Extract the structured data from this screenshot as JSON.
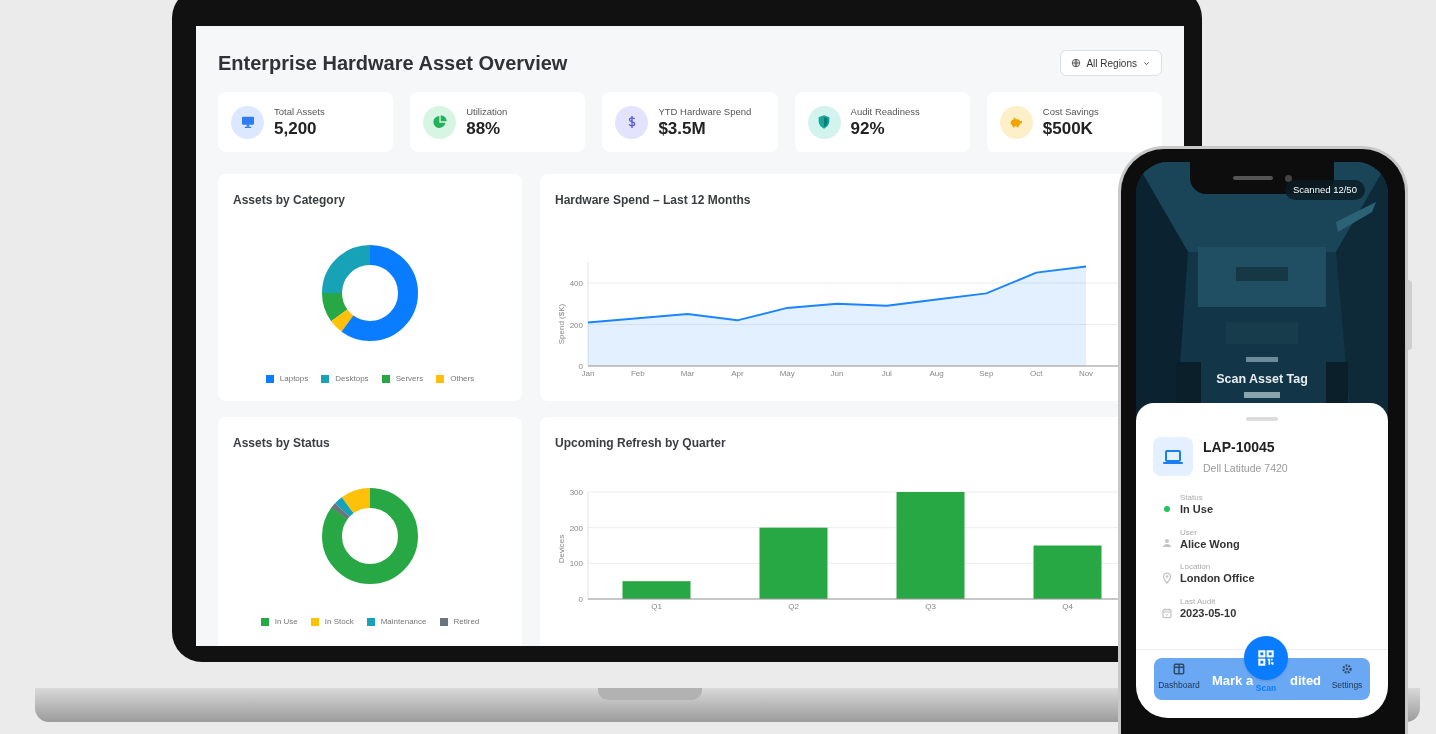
{
  "dashboard": {
    "title": "Enterprise Hardware Asset Overview",
    "region_filter": {
      "label": "All Regions"
    },
    "kpis": [
      {
        "kind": "monitor",
        "label": "Total Assets",
        "value": "5,200"
      },
      {
        "kind": "pie",
        "label": "Utilization",
        "value": "88%"
      },
      {
        "kind": "dollar",
        "label": "YTD Hardware Spend",
        "value": "$3.5M"
      },
      {
        "kind": "shield",
        "label": "Audit Readiness",
        "value": "92%"
      },
      {
        "kind": "piggy",
        "label": "Cost Savings",
        "value": "$500K"
      }
    ],
    "category_card": {
      "title": "Assets by Category",
      "legend": [
        {
          "label": "Laptops",
          "color": "#0a7cff"
        },
        {
          "label": "Desktops",
          "color": "#17a2b8"
        },
        {
          "label": "Servers",
          "color": "#28a745"
        },
        {
          "label": "Others",
          "color": "#ffc107"
        }
      ]
    },
    "spend_card": {
      "title": "Hardware Spend – Last 12 Months",
      "chart_data": {
        "type": "area",
        "ylabel": "Spend ($K)",
        "categories": [
          "Jan",
          "Feb",
          "Mar",
          "Apr",
          "May",
          "Jun",
          "Jul",
          "Aug",
          "Sep",
          "Oct",
          "Nov"
        ],
        "series": [
          {
            "color": "#1a85ff",
            "values": [
              210,
              230,
              250,
              220,
              280,
              300,
              290,
              320,
              350,
              450,
              480
            ]
          }
        ],
        "ylim": [
          0,
          500
        ],
        "yticks": [
          0,
          200,
          400
        ],
        "grid": true
      }
    },
    "status_card": {
      "title": "Assets by Status",
      "legend": [
        {
          "label": "In Use",
          "color": "#28a745"
        },
        {
          "label": "In Stock",
          "color": "#ffc107"
        },
        {
          "label": "Maintenance",
          "color": "#17a2b8"
        },
        {
          "label": "Retired",
          "color": "#6c757d"
        }
      ]
    },
    "refresh_card": {
      "title": "Upcoming Refresh by Quarter",
      "chart_data": {
        "type": "bar",
        "ylabel": "Devices",
        "categories": [
          "Q1",
          "Q2",
          "Q3",
          "Q4"
        ],
        "series": [
          {
            "color": "#28a745",
            "values": [
              50,
              200,
              300,
              150
            ]
          }
        ],
        "ylim": [
          0,
          300
        ],
        "yticks": [
          0,
          100,
          200,
          300
        ],
        "grid": true
      }
    }
  },
  "phone": {
    "scan_counter": "Scanned 12/50",
    "scan_prompt": "Scan Asset Tag",
    "asset": {
      "id": "LAP-10045",
      "model": "Dell Latitude 7420",
      "fields": [
        {
          "kind": "status",
          "label": "Status",
          "value": "In Use"
        },
        {
          "kind": "user",
          "label": "User",
          "value": "Alice Wong"
        },
        {
          "kind": "location",
          "label": "Location",
          "value": "London Office"
        },
        {
          "kind": "date",
          "label": "Last Audit",
          "value": "2023-05-10"
        }
      ]
    },
    "action_button": {
      "left_text": "Mark a",
      "right_text": "dited"
    },
    "nav": [
      {
        "kind": "dashboard",
        "label": "Dashboard",
        "selected": false
      },
      {
        "kind": "scan",
        "label": "Scan",
        "selected": true
      },
      {
        "kind": "settings",
        "label": "Settings",
        "selected": false
      }
    ]
  }
}
